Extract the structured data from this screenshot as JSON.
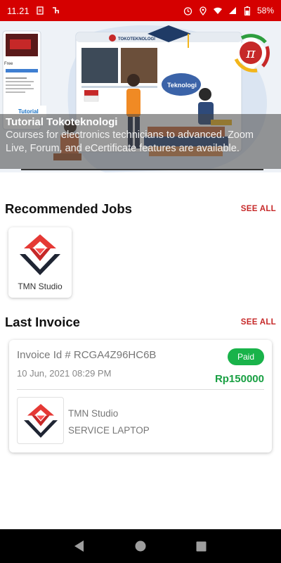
{
  "status_bar": {
    "time": "11.21",
    "battery": "58%",
    "icons": [
      "sim-card-icon",
      "tokped-icon",
      "alarm-icon",
      "location-icon",
      "wifi-icon",
      "signal-icon",
      "battery-icon"
    ]
  },
  "banner": {
    "title": "Tutorial Tokoteknologi",
    "description": "Courses for electronics technicians to advanced. Zoom Live, Forum, and eCertificate features are available.",
    "art_text_brand": "TOKOTEKNOLOGI",
    "art_text_tag": "Teknologi",
    "art_text_tutorial": "Tutorial",
    "art_text_free": "Free"
  },
  "recommended_jobs": {
    "title": "Recommended Jobs",
    "see_all": "SEE ALL",
    "items": [
      {
        "name": "TMN Studio"
      }
    ]
  },
  "last_invoice": {
    "title": "Last Invoice",
    "see_all": "SEE ALL",
    "invoice_id": "Invoice Id # RCGA4Z96HC6B",
    "date": "10 Jun, 2021 08:29 PM",
    "status": "Paid",
    "amount": "Rp150000",
    "shop": "TMN Studio",
    "service": "SERVICE LAPTOP"
  },
  "colors": {
    "accent": "#d50000",
    "see_all": "#c62828",
    "paid": "#19b34a",
    "amount": "#19a043"
  }
}
